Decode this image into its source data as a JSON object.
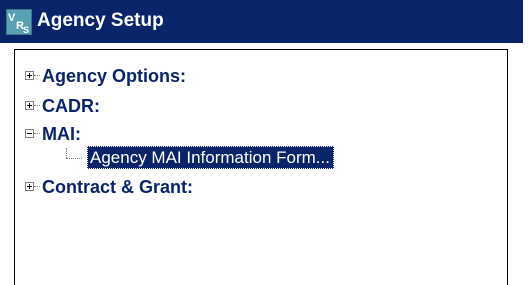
{
  "window": {
    "title": "Agency Setup",
    "icon": "vrs-app-icon"
  },
  "tree": {
    "items": [
      {
        "label": "Agency Options:",
        "expanded": false
      },
      {
        "label": "CADR:",
        "expanded": false
      },
      {
        "label": "MAI:",
        "expanded": true,
        "children": [
          {
            "label": "Agency MAI Information Form...",
            "selected": true
          }
        ]
      },
      {
        "label": "Contract & Grant:",
        "expanded": false
      }
    ]
  },
  "colors": {
    "titlebar": "#0a246a",
    "selection": "#0a246a",
    "label": "#0a246a"
  }
}
